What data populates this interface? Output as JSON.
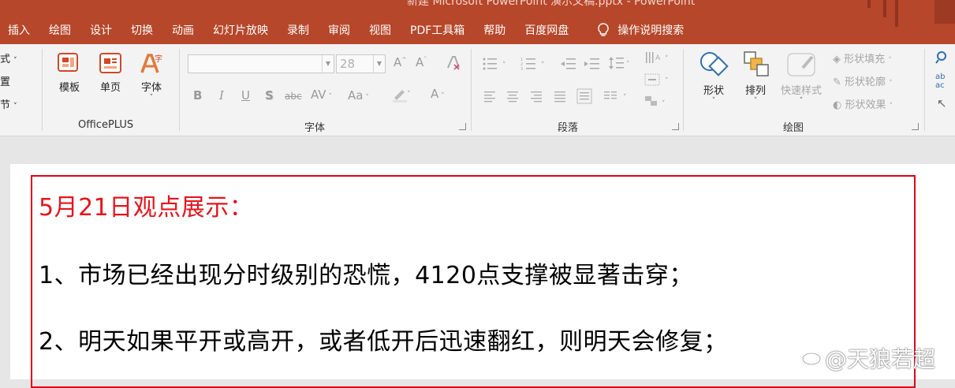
{
  "window": {
    "title": "新建 Microsoft PowerPoint 演示文稿.pptx - PowerPoint"
  },
  "tabs": [
    "插入",
    "绘图",
    "设计",
    "切换",
    "动画",
    "幻灯片放映",
    "录制",
    "审阅",
    "视图",
    "PDF工具箱",
    "帮助",
    "百度网盘"
  ],
  "tell_me": "操作说明搜索",
  "ribbon": {
    "partial_left": [
      "式",
      "置",
      "节"
    ],
    "officeplus": {
      "template": "模板",
      "single_page": "单页",
      "font": "字体",
      "label": "OfficePLUS"
    },
    "font_group": {
      "font_size": "28",
      "label": "字体"
    },
    "paragraph_group": {
      "label": "段落"
    },
    "drawing_group": {
      "shapes": "形状",
      "arrange": "排列",
      "quick_styles": "快速样式",
      "shape_fill": "形状填充",
      "shape_outline": "形状轮廓",
      "shape_effects": "形状效果",
      "label": "绘图"
    }
  },
  "slide": {
    "lines": [
      "5月21日观点展示：",
      "1、市场已经出现分时级别的恐慌，4120点支撑被显著击穿；",
      "2、明天如果平开或高开，或者低开后迅速翻红，则明天会修复；"
    ]
  },
  "watermark": "@天狼若超",
  "colors": {
    "title_bar": "#b7472a",
    "ribbon": "#f3f3f3",
    "highlight_red": "#e8141b",
    "border_red": "#e0001b"
  }
}
